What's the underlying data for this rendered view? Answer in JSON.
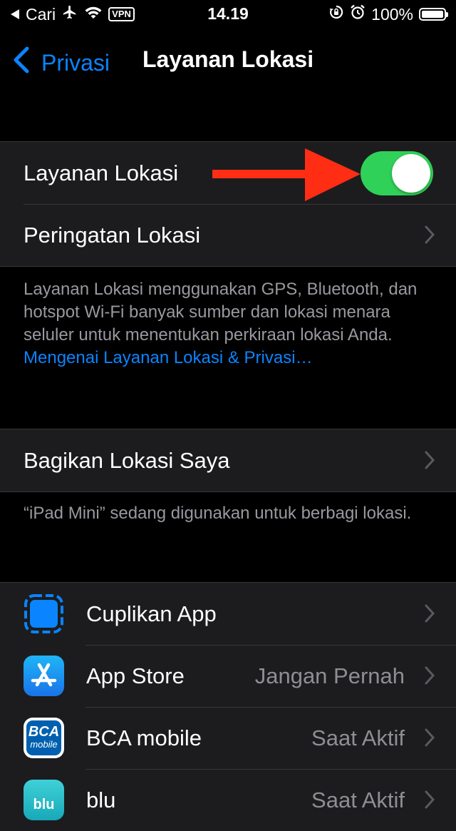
{
  "status_bar": {
    "carrier": "Cari",
    "vpn": "VPN",
    "time": "14.19",
    "battery": "100%"
  },
  "nav": {
    "back_label": "Privasi",
    "title": "Layanan Lokasi"
  },
  "location_group": {
    "toggle_label": "Layanan Lokasi",
    "toggle_on": true,
    "alerts_label": "Peringatan Lokasi"
  },
  "description": {
    "text": "Layanan Lokasi menggunakan GPS, Bluetooth, dan hotspot Wi-Fi banyak sumber dan lokasi menara seluler untuk menentukan perkiraan lokasi Anda. ",
    "link": "Mengenai Layanan Lokasi & Privasi…"
  },
  "share": {
    "label": "Bagikan Lokasi Saya",
    "note": "“iPad  Mini” sedang digunakan untuk berbagi lokasi."
  },
  "apps": [
    {
      "name": "Cuplikan App",
      "value": "",
      "icon": "app-clips-icon"
    },
    {
      "name": "App Store",
      "value": "Jangan Pernah",
      "icon": "app-store-icon"
    },
    {
      "name": "BCA mobile",
      "value": "Saat Aktif",
      "icon": "bca-mobile-icon"
    },
    {
      "name": "blu",
      "value": "Saat Aktif",
      "icon": "blu-icon"
    }
  ],
  "icon_text": {
    "bca": "BCA",
    "bca_sub": "mobile",
    "blu": "blu"
  },
  "colors": {
    "accent": "#0a84ff",
    "toggle_on": "#30d158",
    "annotation_arrow": "#ff2d14"
  }
}
